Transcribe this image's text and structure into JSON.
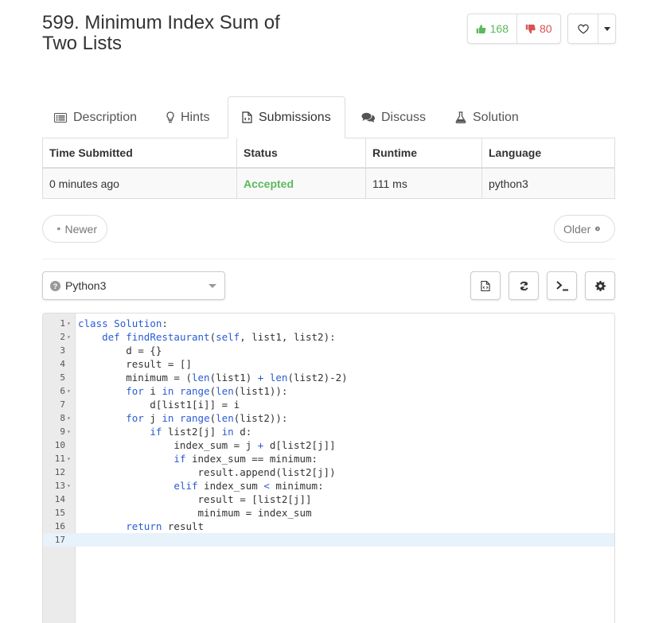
{
  "problem": {
    "title": "599. Minimum Index Sum of Two Lists"
  },
  "votes": {
    "up": "168",
    "down": "80"
  },
  "tabs": [
    {
      "label": "Description",
      "icon": "list-icon"
    },
    {
      "label": "Hints",
      "icon": "lightbulb-icon"
    },
    {
      "label": "Submissions",
      "icon": "code-file-icon"
    },
    {
      "label": "Discuss",
      "icon": "comments-icon"
    },
    {
      "label": "Solution",
      "icon": "flask-icon"
    }
  ],
  "table": {
    "headers": [
      "Time Submitted",
      "Status",
      "Runtime",
      "Language"
    ],
    "row": {
      "time": "0 minutes ago",
      "status": "Accepted",
      "runtime": "111 ms",
      "language": "python3"
    }
  },
  "nav": {
    "newer": "Newer",
    "older": "Older"
  },
  "editor": {
    "language": "Python3",
    "colors": {
      "accepted": "#5cb85c",
      "keyword": "#2a5cd4",
      "upvote": "#5cb85c",
      "downvote": "#d9534f"
    },
    "lines": [
      {
        "num": "1",
        "fold": true,
        "text": "class Solution:"
      },
      {
        "num": "2",
        "fold": true,
        "text": "    def findRestaurant(self, list1, list2):"
      },
      {
        "num": "3",
        "fold": false,
        "text": "        d = {}"
      },
      {
        "num": "4",
        "fold": false,
        "text": "        result = []"
      },
      {
        "num": "5",
        "fold": false,
        "text": "        minimum = (len(list1) + len(list2)-2)"
      },
      {
        "num": "6",
        "fold": true,
        "text": "        for i in range(len(list1)):"
      },
      {
        "num": "7",
        "fold": false,
        "text": "            d[list1[i]] = i"
      },
      {
        "num": "8",
        "fold": true,
        "text": "        for j in range(len(list2)):"
      },
      {
        "num": "9",
        "fold": true,
        "text": "            if list2[j] in d:"
      },
      {
        "num": "10",
        "fold": false,
        "text": "                index_sum = j + d[list2[j]]"
      },
      {
        "num": "11",
        "fold": true,
        "text": "                if index_sum == minimum:"
      },
      {
        "num": "12",
        "fold": false,
        "text": "                    result.append(list2[j])"
      },
      {
        "num": "13",
        "fold": true,
        "text": "                elif index_sum < minimum:"
      },
      {
        "num": "14",
        "fold": false,
        "text": "                    result = [list2[j]]"
      },
      {
        "num": "15",
        "fold": false,
        "text": "                    minimum = index_sum"
      },
      {
        "num": "16",
        "fold": false,
        "text": "        return result"
      },
      {
        "num": "17",
        "fold": false,
        "text": ""
      }
    ]
  }
}
